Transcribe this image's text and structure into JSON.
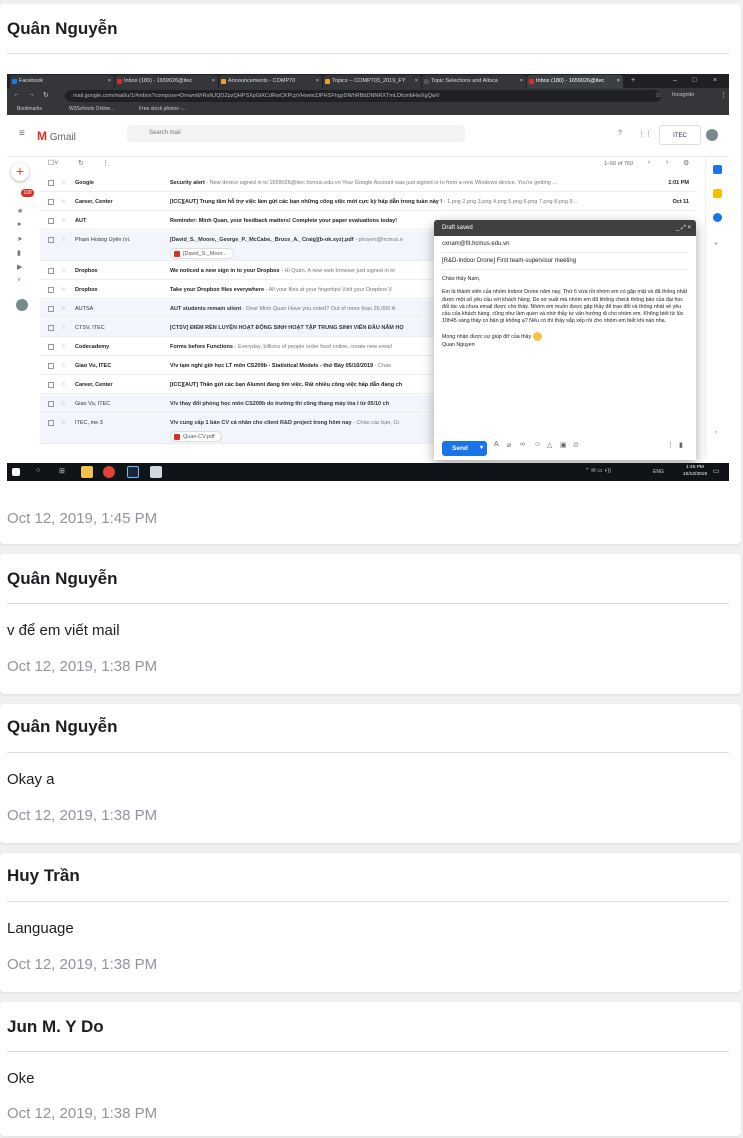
{
  "posts": [
    {
      "author": "Quân Nguyễn",
      "message": "",
      "time": "Oct 12, 2019, 1:45 PM"
    },
    {
      "author": "Quân Nguyễn",
      "message": "v để em viết mail",
      "time": "Oct 12, 2019, 1:38 PM"
    },
    {
      "author": "Quân Nguyễn",
      "message": "Okay a",
      "time": "Oct 12, 2019, 1:38 PM"
    },
    {
      "author": "Huy Trần",
      "message": "Language",
      "time": "Oct 12, 2019, 1:38 PM"
    },
    {
      "author": "Jun M. Y Do",
      "message": "Oke",
      "time": "Oct 12, 2019, 1:38 PM"
    }
  ],
  "screenshot": {
    "tabs": [
      "Facebook",
      "Inbox (180) - 1659026@itec",
      "Announcements - COMP70",
      "Topics -- COMP703_2019_FY",
      "Topic Selections and Alloca",
      "Inbox (180) - 1659026@itec"
    ],
    "url": "mail.google.com/mail/u/1/#inbox?compose=DmwnWrRsNJQDZpzQHPSXpGiKCdRwCKPcpVHwmcDPHSFhgzDWhRBbDNNRXTmLDfcmbHwXgQwV",
    "incognito": "Incognito",
    "bookmarks": [
      "Bookmarks",
      "W3Schools Online...",
      "Free stock photos -..."
    ],
    "gmail_label": "Gmail",
    "search_placeholder": "Search mail",
    "pagination": "1–50 of 760",
    "itec_label": "ITEC",
    "unread_badge": "100",
    "emails": [
      {
        "sender": "Google",
        "subject": "Security alert",
        "snippet": " - New device signed in to 1659026@itec.hcmus.edu.vn Your Google Account was just signed in to from a new Windows device. You're getting ...",
        "date": "1:01 PM",
        "unread": true
      },
      {
        "sender": "Career, Center",
        "subject": "[ICC][AUT] Trung tâm hỗ trợ việc làm gửi các bạn những công việc mới cực kỳ hấp dẫn trong tuần này !",
        "snippet": " - 1.png 2.png 3.png 4.png 5.png 6.png 7.png 8.png 9...",
        "date": "Oct 11",
        "unread": true
      },
      {
        "sender": "AUT",
        "subject": "Reminder: Minh Quan, your feedback matters! Complete your paper evaluations today!",
        "snippet": "",
        "date": "",
        "unread": true
      },
      {
        "sender": "Phạm Hoàng Uyên (vi.",
        "subject": "[David_S._Moore,_George_P._McCabe,_Bruce_A._Craig](b-ok.xyz).pdf",
        "snippet": " - phuyen@hcmus.e",
        "date": "",
        "unread": false,
        "attachment": "[David_S._Moor..."
      },
      {
        "sender": "Dropbox",
        "subject": "We noticed a new sign in to your Dropbox",
        "snippet": " - Hi Quân, A new web browser just signed in to",
        "date": "",
        "unread": true
      },
      {
        "sender": "Dropbox",
        "subject": "Take your Dropbox files everywhere",
        "snippet": " - All your files at your fingertips Visit your Dropbox V",
        "date": "",
        "unread": true
      },
      {
        "sender": "AUTSA",
        "subject": "AUT students remain silent",
        "snippet": " - Dear Minh Quan Have you voted? Out of more than 26,000 A",
        "date": "",
        "unread": false
      },
      {
        "sender": "CTSV, ITEC",
        "subject": "[CTSV] ĐIỂM RÈN LUYỆN HOẠT ĐỘNG SINH HOẠT TẬP TRUNG SINH VIÊN ĐẦU NĂM HỌ",
        "snippet": "",
        "date": "",
        "unread": false
      },
      {
        "sender": "Codecademy",
        "subject": "Forms before Functions",
        "snippet": " - Everyday, billions of people order food online, create new email",
        "date": "",
        "unread": true
      },
      {
        "sender": "Giao Vu, ITEC",
        "subject": "V/v tạm nghỉ giờ học LT môn CS209b - Statistical Models - thứ Bảy 05/10/2019",
        "snippet": " - Chào",
        "date": "",
        "unread": true
      },
      {
        "sender": "Career, Center",
        "subject": "[ICC][AUT] Thân gửi các bạn Alumni đang tìm việc. Rất nhiều công việc hấp dẫn đang ch",
        "snippet": "",
        "date": "",
        "unread": true
      },
      {
        "sender": "Giao Vu, ITEC",
        "subject": "V/v thay đổi phòng học môn CS209b do trường thi công thang máy tòa I từ 05/10 ch",
        "snippet": "",
        "date": "",
        "unread": false
      },
      {
        "sender": "ITEC, me 3",
        "subject": "V/v cung cấp 1 bản CV cá nhân cho client R&D project trong hôm nay",
        "snippet": " - Chào các bạn, Gi",
        "date": "",
        "unread": false,
        "attachment": "Quan-CV.pdf"
      }
    ],
    "draft": {
      "header": "Draft saved",
      "to": "cxnam@fit.hcmus.edu.vn",
      "subject": "[R&D-Indoor Drone] First team-supervisor meeting",
      "greeting": "Chào thầy Nam,",
      "body": "Em là thành viên của nhóm Indoor Drone năm nay. Thứ 6 vừa rồi nhóm em có gặp mặt và đã thống nhất được một số yêu cầu với khách hàng. Do sơ suất mà nhóm em đã không check thông báo của đại học đối tác và chưa email được cho thầy. Nhóm em muốn được gặp thầy để trao đổi và thông nhất về yêu cầu của khách hàng, cũng như làm quen và nhờ thầy tư vấn hướng đi cho nhóm em. Không biết từ lúc 10h45 sáng thầy có bận gì không ạ? Nếu có thì thầy sắp xếp rồi cho nhóm em biết khi nào nha.",
      "closing": "Mong nhận được sự giúp đỡ của thầy",
      "signature": "Quan Nguyen",
      "send_label": "Send"
    },
    "taskbar": {
      "time": "1:45 PM",
      "date": "10/12/2019",
      "lang": "ENG"
    }
  }
}
